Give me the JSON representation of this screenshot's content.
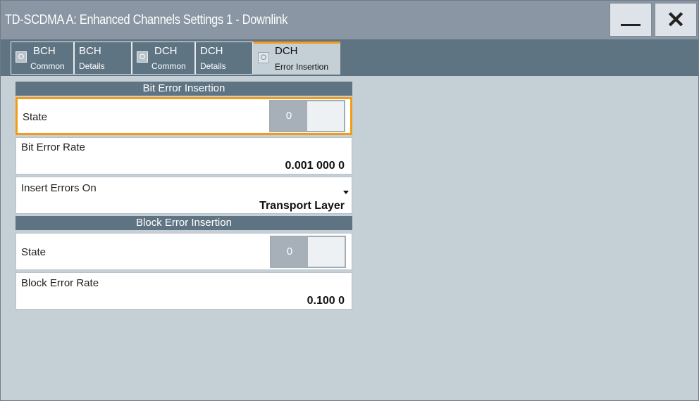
{
  "window": {
    "title": "TD-SCDMA A: Enhanced Channels Settings 1 - Downlink",
    "minimize_label": "—",
    "close_label": "✕"
  },
  "tabs": [
    {
      "line1": "BCH",
      "line2": "Common",
      "led": "O"
    },
    {
      "line1": "BCH",
      "line2": "Details"
    },
    {
      "line1": "DCH",
      "line2": "Common",
      "led": "O"
    },
    {
      "line1": "DCH",
      "line2": "Details"
    },
    {
      "line1": "DCH",
      "line2": "Error Insertion",
      "led": "O",
      "active": true
    }
  ],
  "bit_error": {
    "header": "Bit Error Insertion",
    "state_label": "State",
    "state_value": "0",
    "rate_label": "Bit Error Rate",
    "rate_value": "0.001 000 0",
    "insert_label": "Insert Errors On",
    "insert_value": "Transport Layer"
  },
  "block_error": {
    "header": "Block Error Insertion",
    "state_label": "State",
    "state_value": "0",
    "rate_label": "Block Error Rate",
    "rate_value": "0.100 0"
  },
  "colors": {
    "accent": "#f59a13",
    "title_bar": "#8a96a3",
    "tab_strip": "#5f7482",
    "background": "#c5cfd6"
  }
}
